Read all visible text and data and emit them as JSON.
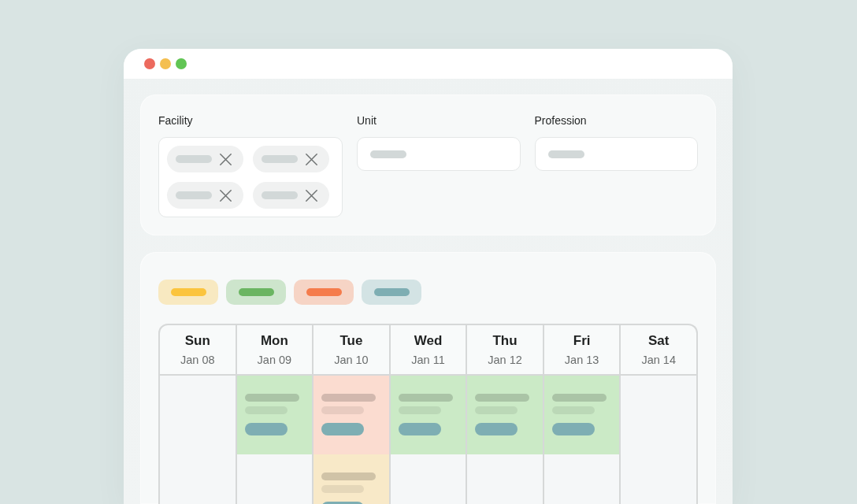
{
  "filters": [
    {
      "kind": "chips",
      "label": "Facility",
      "chips": [
        {
          "removable": true
        },
        {
          "removable": true
        },
        {
          "removable": true
        },
        {
          "removable": true
        }
      ]
    },
    {
      "kind": "select",
      "label": "Unit"
    },
    {
      "kind": "select",
      "label": "Profession"
    }
  ],
  "legend": [
    {
      "color": "#fbc43e"
    },
    {
      "color": "#6bb562"
    },
    {
      "color": "#f57c4c"
    },
    {
      "color": "#7eaeb3"
    }
  ],
  "calendar": {
    "days": [
      {
        "name": "Sun",
        "date": "Jan 08"
      },
      {
        "name": "Mon",
        "date": "Jan 09"
      },
      {
        "name": "Tue",
        "date": "Jan 10"
      },
      {
        "name": "Wed",
        "date": "Jan 11"
      },
      {
        "name": "Thu",
        "date": "Jan 12"
      },
      {
        "name": "Fri",
        "date": "Jan 13"
      },
      {
        "name": "Sat",
        "date": "Jan 14"
      }
    ],
    "rows": [
      {
        "cells": [
          {
            "shift": false
          },
          {
            "shift": true,
            "color": "#cbeac6"
          },
          {
            "shift": true,
            "color": "#fbdcd0"
          },
          {
            "shift": true,
            "color": "#cbeac6"
          },
          {
            "shift": true,
            "color": "#cbeac6"
          },
          {
            "shift": true,
            "color": "#cbeac6"
          },
          {
            "shift": false
          }
        ]
      },
      {
        "cells": [
          {
            "shift": false
          },
          {
            "shift": false
          },
          {
            "shift": true,
            "color": "#f8e9c8"
          },
          {
            "shift": false
          },
          {
            "shift": false
          },
          {
            "shift": false
          },
          {
            "shift": false
          }
        ]
      }
    ]
  }
}
